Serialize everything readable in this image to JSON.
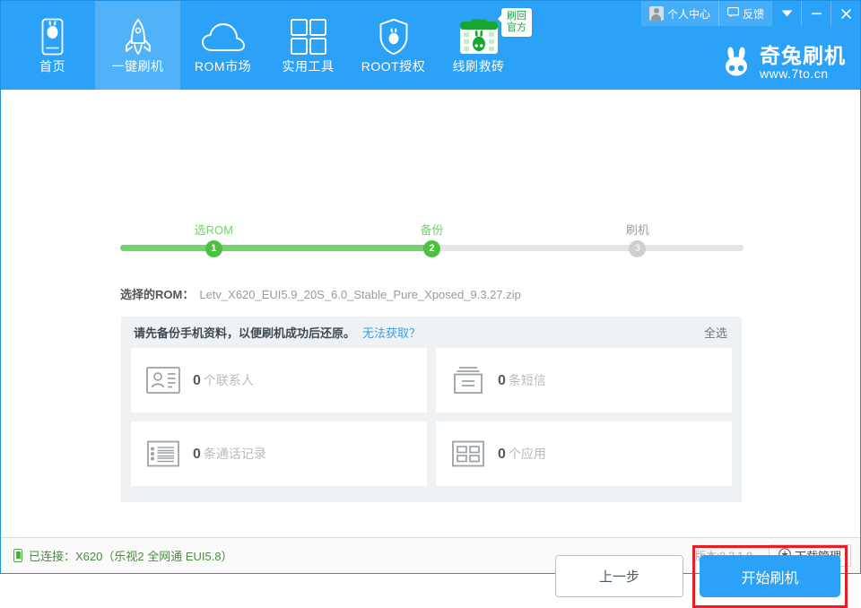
{
  "titlebar": {
    "user_center": "个人中心",
    "feedback": "反馈",
    "dropdown_glyph": "▼",
    "minimize_glyph": "–",
    "close_glyph": "✕"
  },
  "brand": {
    "name": "奇兔刷机",
    "url": "www.7to.cn"
  },
  "nav": {
    "items": [
      {
        "label": "首页",
        "icon": "phone-home-icon",
        "active": false,
        "badge": ""
      },
      {
        "label": "一键刷机",
        "icon": "rocket-icon",
        "active": true,
        "badge": ""
      },
      {
        "label": "ROM市场",
        "icon": "cloud-icon",
        "active": false,
        "badge": ""
      },
      {
        "label": "实用工具",
        "icon": "grid-tools-icon",
        "active": false,
        "badge": ""
      },
      {
        "label": "ROOT授权",
        "icon": "shield-icon",
        "active": false,
        "badge": ""
      },
      {
        "label": "线刷救砖",
        "icon": "rescue-box-icon",
        "active": false,
        "badge": "刷回官方"
      }
    ]
  },
  "steps": {
    "items": [
      {
        "label": "选ROM",
        "number": "1",
        "state": "done",
        "pos": 15
      },
      {
        "label": "备份",
        "number": "2",
        "state": "current",
        "pos": 50
      },
      {
        "label": "刷机",
        "number": "3",
        "state": "pending",
        "pos": 83
      }
    ],
    "fill_percent": 50
  },
  "rom": {
    "label": "选择的ROM：",
    "value": "Letv_X620_EUI5.9_20S_6.0_Stable_Pure_Xposed_9.3.27.zip"
  },
  "backup_panel": {
    "title": "请先备份手机资料，以便刷机成功后还原。",
    "help_link": "无法获取？",
    "select_all": "全选",
    "cards": [
      {
        "icon": "contact-card-icon",
        "count": "0",
        "unit": "个联系人"
      },
      {
        "icon": "sms-icon",
        "count": "0",
        "unit": "条短信"
      },
      {
        "icon": "call-log-icon",
        "count": "0",
        "unit": "条通话记录"
      },
      {
        "icon": "apps-grid-icon",
        "count": "0",
        "unit": "个应用"
      }
    ]
  },
  "footer_buttons": {
    "prev": "上一步",
    "start": "开始刷机",
    "highlight_color": "#ec1c24"
  },
  "statusbar": {
    "connection": "已连接：X620（乐视2 全网通 EUI5.8）",
    "version": "版本:8.2.1.9",
    "download_manager": "下载管理"
  },
  "colors": {
    "header_blue": "#2ba1f8",
    "accent_green": "#4cc03f",
    "link_blue": "#3fa0e8",
    "panel_bg": "#eef2f4",
    "highlight_red": "#ec1c24"
  }
}
